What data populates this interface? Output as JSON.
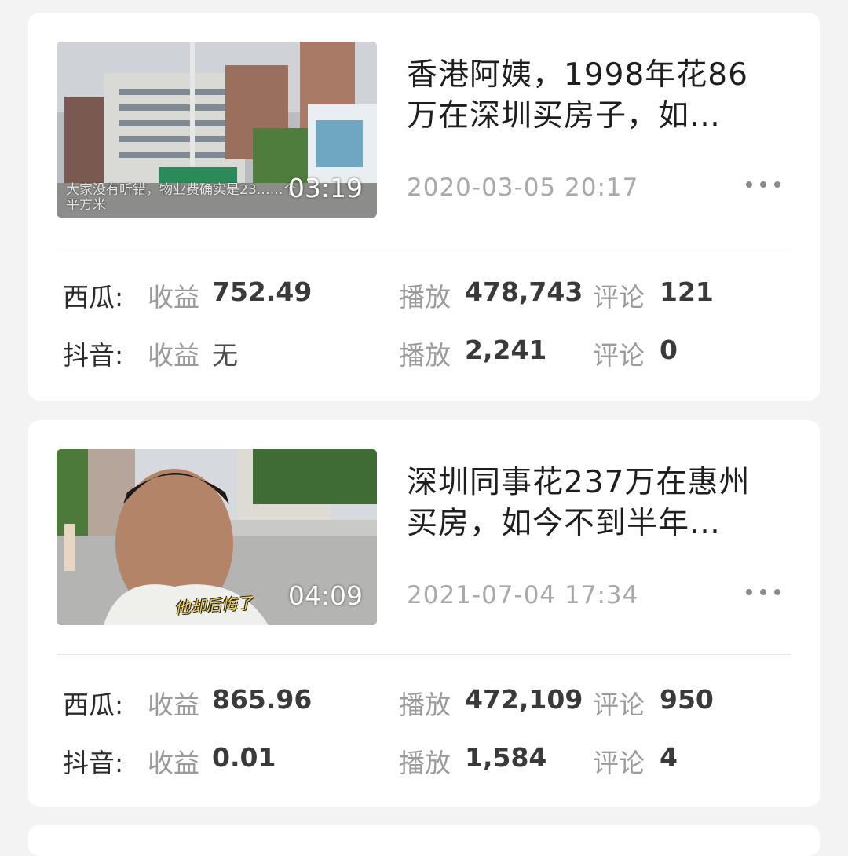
{
  "videos": [
    {
      "title_line1": "香港阿姨，1998年花86",
      "title_line2": "万在深圳买房子，如…",
      "date": "2020-03-05 20:17",
      "duration": "03:19",
      "thumbnail_caption": "大家没有听错，物业费确实是23……个平方米",
      "stats": [
        {
          "platform": "西瓜:",
          "income_label": "收益",
          "income": "752.49",
          "play_label": "播放",
          "plays": "478,743",
          "comment_label": "评论",
          "comments": "121"
        },
        {
          "platform": "抖音:",
          "income_label": "收益",
          "income": "无",
          "play_label": "播放",
          "plays": "2,241",
          "comment_label": "评论",
          "comments": "0"
        }
      ]
    },
    {
      "title_line1": "深圳同事花237万在惠州",
      "title_line2": "买房，如今不到半年…",
      "date": "2021-07-04 17:34",
      "duration": "04:09",
      "thumbnail_caption": "他却后悔了",
      "stats": [
        {
          "platform": "西瓜:",
          "income_label": "收益",
          "income": "865.96",
          "play_label": "播放",
          "plays": "472,109",
          "comment_label": "评论",
          "comments": "950"
        },
        {
          "platform": "抖音:",
          "income_label": "收益",
          "income": "0.01",
          "play_label": "播放",
          "plays": "1,584",
          "comment_label": "评论",
          "comments": "4"
        }
      ]
    }
  ],
  "icons": {
    "more": "more-horizontal-icon"
  }
}
